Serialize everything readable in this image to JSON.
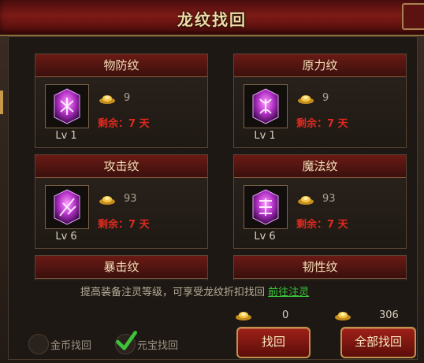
{
  "window": {
    "title": "龙纹找回"
  },
  "cards": [
    {
      "name": "物防纹",
      "cost": "9",
      "remain": "剩余：7 天",
      "level": "Lv 1",
      "icon": "defense-rune-icon"
    },
    {
      "name": "原力纹",
      "cost": "9",
      "remain": "剩余：7 天",
      "level": "Lv 1",
      "icon": "force-rune-icon"
    },
    {
      "name": "攻击纹",
      "cost": "93",
      "remain": "剩余：7 天",
      "level": "Lv 6",
      "icon": "attack-rune-icon"
    },
    {
      "name": "魔法纹",
      "cost": "93",
      "remain": "剩余：7 天",
      "level": "Lv 6",
      "icon": "magic-rune-icon"
    },
    {
      "name": "暴击纹"
    },
    {
      "name": "韧性纹"
    }
  ],
  "footer": {
    "hint": "提高装备注灵等级，可享受龙纹折扣找回",
    "hint_link": "前往注灵",
    "gold_total": "0",
    "ingot_total": "306",
    "option_gold": "金币找回",
    "option_ingot": "元宝找回",
    "retrieve_button": "找回",
    "retrieve_all_button": "全部找回"
  },
  "colors": {
    "accent_red": "#e02a1e",
    "link_green": "#39c93a",
    "title_gold": "#f0dca8"
  }
}
